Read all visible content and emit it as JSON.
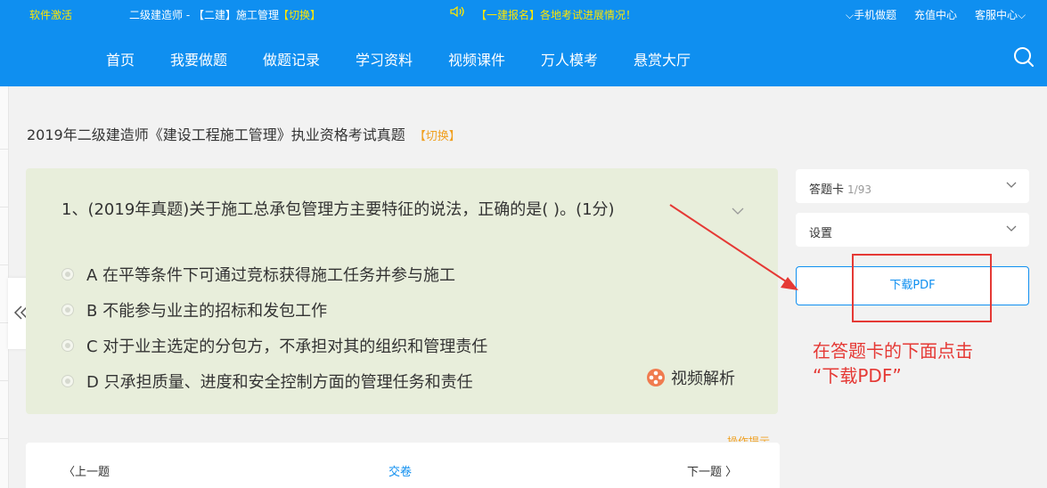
{
  "header": {
    "software_activate": "软件激活",
    "exam_name": "二级建造师 - 【二建】施工管理",
    "exam_switch": "【切换】",
    "announcement": "【一建报名】各地考试进展情况！",
    "mobile_practice": "手机做题",
    "recharge": "充值中心",
    "service": "客服中心"
  },
  "nav": {
    "items": [
      "首页",
      "我要做题",
      "做题记录",
      "学习资料",
      "视频课件",
      "万人模考",
      "悬赏大厅"
    ]
  },
  "page": {
    "title": "2019年二级建造师《建设工程施工管理》执业资格考试真题",
    "switch_label": "【切换】"
  },
  "question": {
    "text": "1、(2019年真题)关于施工总承包管理方主要特征的说法，正确的是( )。(1分)",
    "options": [
      "A 在平等条件下可通过竞标获得施工任务并参与施工",
      "B 不能参与业主的招标和发包工作",
      "C 对于业主选定的分包方，不承担对其的组织和管理责任",
      "D 只承担质量、进度和安全控制方面的管理任务和责任"
    ],
    "video_label": "视频解析"
  },
  "tips": "操作提示",
  "bottom_nav": {
    "prev": "上一题",
    "submit": "交卷",
    "next": "下一题"
  },
  "sidebar": {
    "answer_card_label": "答题卡",
    "answer_card_progress": "1/93",
    "settings_label": "设置",
    "download_label": "下载PDF"
  },
  "annotation": {
    "line1": "在答题卡的下面点击",
    "line2": "“下载PDF”"
  },
  "colors": {
    "brand_blue": "#0f8ff0",
    "question_bg": "#e8eedb",
    "annotation_red": "#e53935",
    "accent_orange": "#f0a020"
  }
}
